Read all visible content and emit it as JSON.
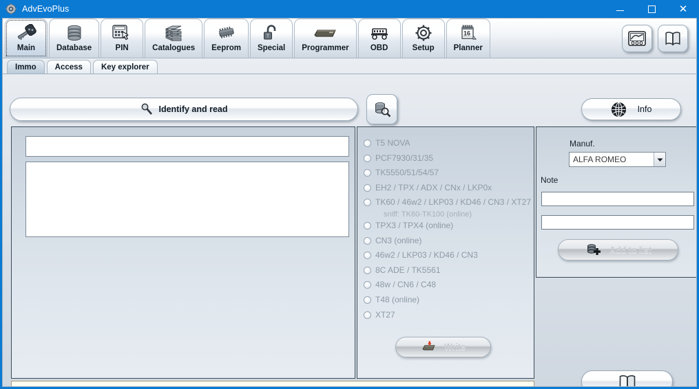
{
  "window": {
    "title": "AdvEvoPlus",
    "app_icon": "gear-app-icon",
    "titlebar_color": "#0b7ad3",
    "controls": {
      "minimize": "minimize-icon",
      "maximize": "maximize-icon",
      "close": "close-icon"
    }
  },
  "ribbon": {
    "buttons": [
      {
        "label": "Main",
        "icon": "car-key-icon",
        "selected": true
      },
      {
        "label": "Database",
        "icon": "database-icon",
        "selected": false
      },
      {
        "label": "PIN",
        "icon": "keypad-hand-icon",
        "selected": false
      },
      {
        "label": "Catalogues",
        "icon": "books-stack-icon",
        "selected": false
      },
      {
        "label": "Eeprom",
        "icon": "chip-icon",
        "selected": false
      },
      {
        "label": "Special",
        "icon": "open-padlock-icon",
        "selected": false
      },
      {
        "label": "Programmer",
        "icon": "programmer-device-icon",
        "selected": false
      },
      {
        "label": "OBD",
        "icon": "obd-connector-icon",
        "selected": false
      },
      {
        "label": "Setup",
        "icon": "gear-icon",
        "selected": false
      },
      {
        "label": "Planner",
        "icon": "calendar-16-icon",
        "selected": false
      }
    ],
    "right_buttons": [
      {
        "name": "oscilloscope-button",
        "icon": "oscilloscope-icon"
      },
      {
        "name": "manual-book-button",
        "icon": "open-book-icon"
      }
    ]
  },
  "subtabs": [
    {
      "label": "Immo",
      "selected": true
    },
    {
      "label": "Access",
      "selected": false
    },
    {
      "label": "Key explorer",
      "selected": false
    }
  ],
  "actionbar": {
    "identify": {
      "label": "Identify and read",
      "icon": "magnifier-icon"
    },
    "db_search": {
      "icon": "database-search-icon"
    },
    "info": {
      "label": "Info",
      "icon": "globe-icon"
    }
  },
  "left_panel": {
    "field_value": "",
    "log_value": ""
  },
  "transponders": {
    "options": [
      {
        "label": "T5 NOVA",
        "sub": "",
        "selected": false,
        "enabled": false
      },
      {
        "label": "PCF7930/31/35",
        "sub": "",
        "selected": false,
        "enabled": false
      },
      {
        "label": "TK5550/51/54/57",
        "sub": "",
        "selected": false,
        "enabled": false
      },
      {
        "label": "EH2 / TPX / ADX / CNx / LKP0x",
        "sub": "",
        "selected": false,
        "enabled": false
      },
      {
        "label": "TK60 / 46w2 / LKP03 / KD46 / CN3 / XT27",
        "sub": "sniff: TK60-TK100 (online)",
        "selected": false,
        "enabled": false
      },
      {
        "label": "TPX3 / TPX4 (online)",
        "sub": "",
        "selected": false,
        "enabled": false
      },
      {
        "label": "CN3 (online)",
        "sub": "",
        "selected": false,
        "enabled": false
      },
      {
        "label": "46w2 / LKP03 / KD46 / CN3",
        "sub": "",
        "selected": false,
        "enabled": false
      },
      {
        "label": "8C ADE / TK5561",
        "sub": "",
        "selected": false,
        "enabled": false
      },
      {
        "label": "48w / CN6 / C48",
        "sub": "",
        "selected": false,
        "enabled": false
      },
      {
        "label": "T48 (online)",
        "sub": "",
        "selected": false,
        "enabled": false
      },
      {
        "label": "XT27",
        "sub": "",
        "selected": false,
        "enabled": false
      }
    ],
    "write_button": {
      "label": "Write",
      "icon": "write-chip-icon",
      "enabled": false
    }
  },
  "right_panel": {
    "manuf_label": "Manuf.",
    "manuf_value": "ALFA ROMEO",
    "manuf_dropdown_icon": "chevron-down-icon",
    "note_label": "Note",
    "note1_value": "",
    "note2_value": "",
    "add_button": {
      "label": "Add to list",
      "icon": "database-plus-icon",
      "enabled": false
    }
  },
  "statusbar": {
    "text": "",
    "background": "#fffcf0"
  },
  "bottom_book_button": {
    "icon": "open-book-icon"
  }
}
